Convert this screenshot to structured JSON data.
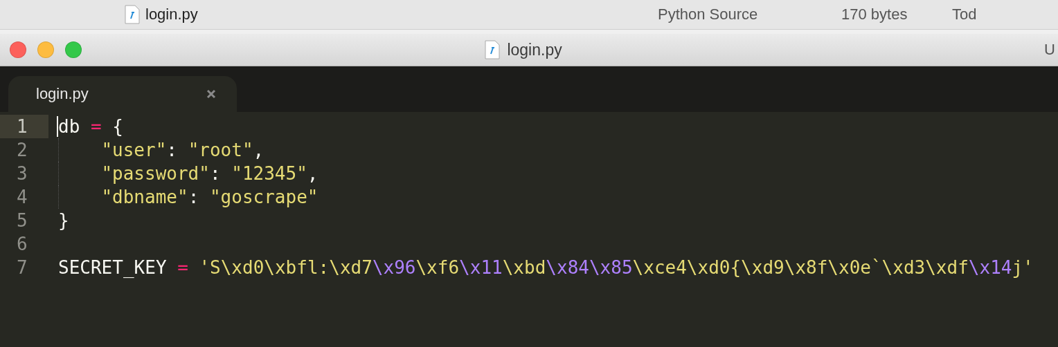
{
  "finder_row": {
    "name": "login.py",
    "kind": "Python Source",
    "size": "170 bytes",
    "date": "Tod"
  },
  "window": {
    "title": "login.py",
    "title_right": "U"
  },
  "tabs": [
    {
      "label": "login.py",
      "selected": true
    }
  ],
  "editor": {
    "lines": [
      {
        "number": "1",
        "current": true,
        "indented": false,
        "tokens": [
          {
            "kind": "plain",
            "text": "db"
          },
          {
            "kind": "operator",
            "text": "="
          },
          {
            "kind": "plain",
            "text": "{"
          }
        ]
      },
      {
        "number": "2",
        "current": false,
        "indented": true,
        "tokens": [
          {
            "kind": "string",
            "text": "\"user\""
          },
          {
            "kind": "plain",
            "text": ": "
          },
          {
            "kind": "string",
            "text": "\"root\""
          },
          {
            "kind": "plain",
            "text": ","
          }
        ]
      },
      {
        "number": "3",
        "current": false,
        "indented": true,
        "tokens": [
          {
            "kind": "string",
            "text": "\"password\""
          },
          {
            "kind": "plain",
            "text": ": "
          },
          {
            "kind": "string",
            "text": "\"12345\""
          },
          {
            "kind": "plain",
            "text": ","
          }
        ]
      },
      {
        "number": "4",
        "current": false,
        "indented": true,
        "tokens": [
          {
            "kind": "string",
            "text": "\"dbname\""
          },
          {
            "kind": "plain",
            "text": ": "
          },
          {
            "kind": "string",
            "text": "\"goscrape\""
          }
        ]
      },
      {
        "number": "5",
        "current": false,
        "indented": false,
        "tokens": [
          {
            "kind": "plain",
            "text": "}"
          }
        ]
      },
      {
        "number": "6",
        "current": false
      },
      {
        "number": "7",
        "current": false,
        "indented": false,
        "tokens": [
          {
            "kind": "plain",
            "text": "SECRET_KEY"
          },
          {
            "kind": "operator",
            "text": "="
          },
          {
            "kind": "string",
            "text": "'S\\xd0\\xbfl:\\xd7"
          },
          {
            "kind": "escape",
            "text": "\\x96"
          },
          {
            "kind": "string",
            "text": "\\xf6"
          },
          {
            "kind": "escape",
            "text": "\\x11"
          },
          {
            "kind": "string",
            "text": "\\xbd"
          },
          {
            "kind": "escape",
            "text": "\\x84\\x85"
          },
          {
            "kind": "string",
            "text": "\\xce4\\xd0{\\xd9\\x8f\\x0e`\\xd3\\xdf"
          },
          {
            "kind": "escape",
            "text": "\\x14"
          },
          {
            "kind": "string",
            "text": "j'"
          }
        ]
      }
    ]
  }
}
